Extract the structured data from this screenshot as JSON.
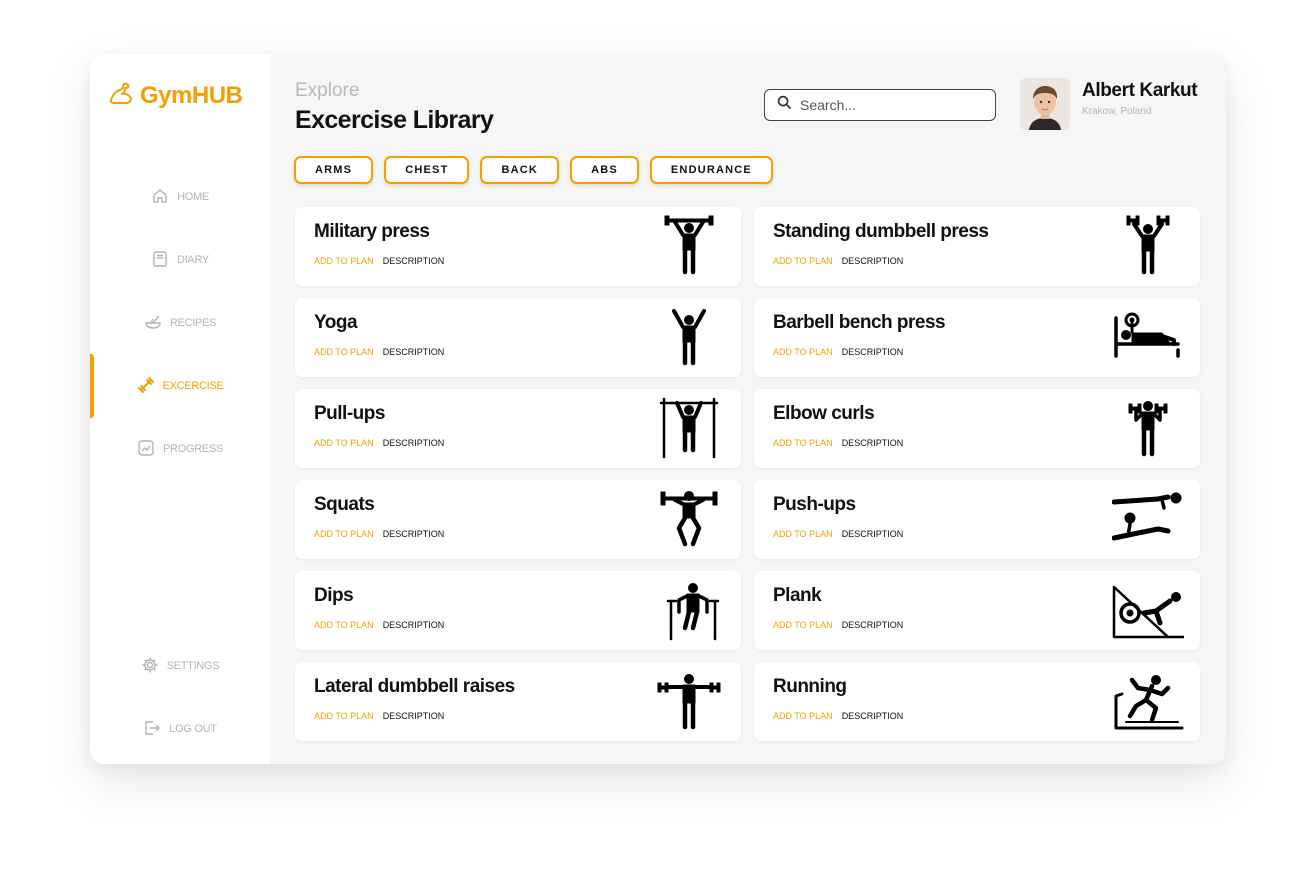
{
  "brand": {
    "name": "GymHUB",
    "accent": "#f5a000"
  },
  "sidebar": {
    "items": [
      {
        "label": "HOME",
        "icon": "home-icon"
      },
      {
        "label": "DIARY",
        "icon": "book-icon"
      },
      {
        "label": "RECIPES",
        "icon": "bowl-icon"
      },
      {
        "label": "EXCERCISE",
        "icon": "dumbbell-icon",
        "active": true
      },
      {
        "label": "PROGRESS",
        "icon": "chart-icon"
      }
    ],
    "bottom": [
      {
        "label": "SETTINGS",
        "icon": "gear-icon"
      },
      {
        "label": "LOG OUT",
        "icon": "logout-icon"
      }
    ]
  },
  "header": {
    "subtitle": "Explore",
    "title": "Excercise Library",
    "search": {
      "placeholder": "Search..."
    },
    "user": {
      "name": "Albert Karkut",
      "location": "Krakow, Poland"
    }
  },
  "filters": [
    "ARMS",
    "CHEST",
    "BACK",
    "ABS",
    "ENDURANCE"
  ],
  "card_actions": {
    "add": "ADD TO PLAN",
    "description": "DESCRIPTION"
  },
  "exercises": [
    {
      "name": "Military press",
      "icon": "overhead-press-icon"
    },
    {
      "name": "Standing dumbbell press",
      "icon": "dumbbell-press-icon"
    },
    {
      "name": "Yoga",
      "icon": "yoga-icon"
    },
    {
      "name": "Barbell bench press",
      "icon": "bench-press-icon"
    },
    {
      "name": "Pull-ups",
      "icon": "pull-up-icon"
    },
    {
      "name": "Elbow curls",
      "icon": "curl-icon"
    },
    {
      "name": "Squats",
      "icon": "squat-icon"
    },
    {
      "name": "Push-ups",
      "icon": "push-up-icon"
    },
    {
      "name": "Dips",
      "icon": "dips-icon"
    },
    {
      "name": "Plank",
      "icon": "plank-icon"
    },
    {
      "name": "Lateral dumbbell raises",
      "icon": "lateral-raise-icon"
    },
    {
      "name": "Running",
      "icon": "treadmill-icon"
    }
  ]
}
